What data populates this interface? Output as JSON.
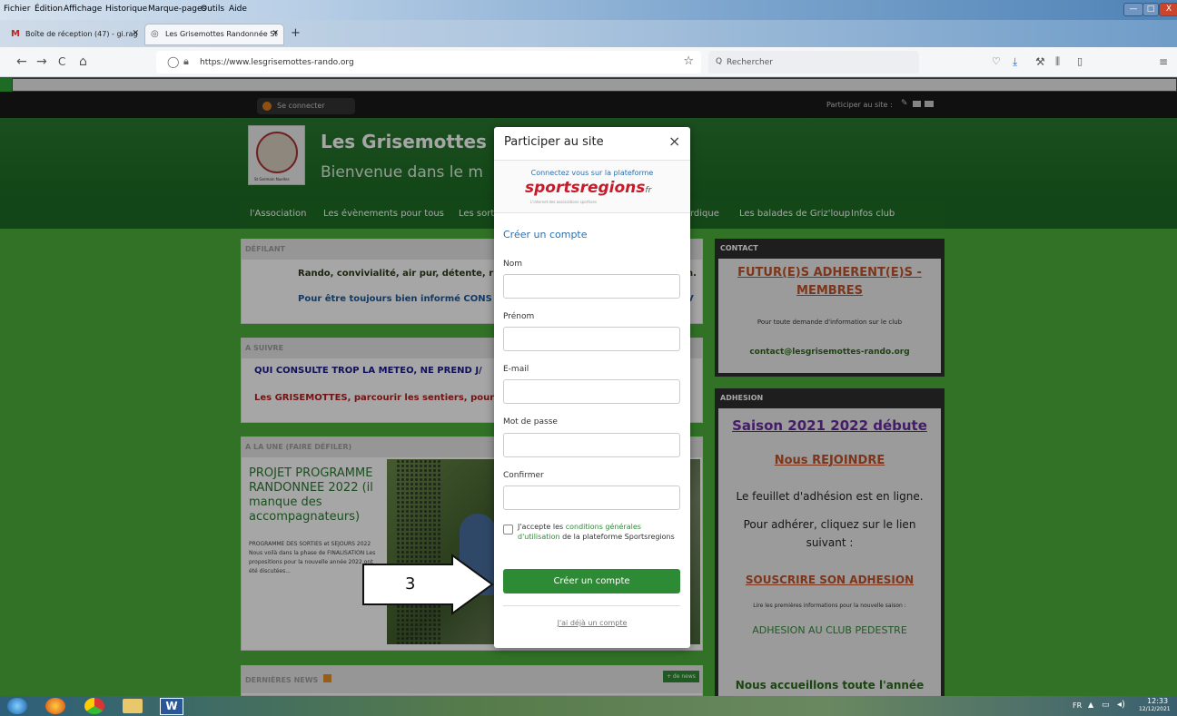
{
  "menubar": {
    "items": [
      "Fichier",
      "Édition",
      "Affichage",
      "Historique",
      "Marque-pages",
      "Outils",
      "Aide"
    ],
    "shortcut_letters": [
      "F",
      "o",
      "A",
      "H",
      "M",
      "O",
      "e"
    ],
    "min_label": "—",
    "max_label": "□",
    "close_label": "X"
  },
  "tabs": [
    {
      "label": "Boîte de réception (47) - gi.rag",
      "icon": "M",
      "close": "✕"
    },
    {
      "label": "Les Grisemottes Randonnée St",
      "icon": "◎",
      "close": "✕"
    }
  ],
  "new_tab_label": "+",
  "nav": {
    "back": "←",
    "forward": "→",
    "reload": "C",
    "home": "⌂",
    "url": "https://www.lesgrisemottes-rando.org",
    "star": "☆",
    "search_placeholder": "Rechercher",
    "search_icon": "Q"
  },
  "site": {
    "login": "Se connecter",
    "participate": "Participer au site :",
    "title": "Les Grisemottes",
    "subtitle": "Bienvenue dans le m",
    "logo_caption": "St Germain Nuelles",
    "nav_items": [
      "l'Association",
      "Les évènements pour tous",
      "Les sorti",
      "rdique",
      "Les balades de Griz'loup",
      "Infos club"
    ],
    "defilant": {
      "title": "DÉFILANT",
      "line1": "Rando, convivialité, air pur, détente, r",
      "line1_tail": "n.",
      "line2": "Pour être toujours bien informé CONS",
      "line2_tail": "V"
    },
    "a_suivre": {
      "title": "A SUIVRE",
      "line1": "QUI CONSULTE TROP LA METEO, NE PREND J/",
      "line2": "Les GRISEMOTTES, parcourir les sentiers, pour"
    },
    "a_la_une": {
      "title": "A LA UNE (FAIRE DÉFILER)",
      "headline": "PROJET PROGRAMME RANDONNEE 2022 (il manque des accompagnateurs)",
      "body": "PROGRAMME DES SORTIES et SEJOURS 2022 Nous voilà dans la phase de FINALISATION Les propositions pour la nouvelle année 2022 ont été discutées..."
    },
    "dernieres": {
      "title": "DERNIÈRES NEWS",
      "more": "+ de news"
    },
    "contact": {
      "title": "CONTACT",
      "heading": "FUTUR(E)S ADHERENT(E)S - MEMBRES",
      "info": "Pour toute demande d'information sur le club",
      "email": "contact@lesgrisemottes-rando.org"
    },
    "adhesion": {
      "title": "ADHESION",
      "season": "Saison 2021 2022 débute",
      "join": "Nous REJOINDRE",
      "line1": "Le feuillet d'adhésion est en ligne.",
      "line2": "Pour adhérer, cliquez sur le lien suivant :",
      "subscribe": "SOUSCRIRE SON ADHESION",
      "small": "Lire les premières informations pour la nouvelle saison :",
      "big": "ADHESION AU CLUB PEDESTRE",
      "welcome": "Nous accueillons toute l'année"
    }
  },
  "modal": {
    "title": "Participer au site",
    "close": "×",
    "connect_text": "Connectez vous sur la plateforme",
    "brand": "sportsregions",
    "brand_tld": "fr",
    "brand_tagline": "L'internet des associations sportives",
    "create_heading": "Créer un compte",
    "fields": {
      "nom": "Nom",
      "prenom": "Prénom",
      "email": "E-mail",
      "password": "Mot de passe",
      "confirm": "Confirmer"
    },
    "accept_prefix": "J'accepte les ",
    "accept_link": "conditions générales d'utilisation",
    "accept_suffix": " de la plateforme Sportsregions",
    "submit": "Créer un compte",
    "already": "J'ai déjà un compte"
  },
  "annotation": {
    "number": "3"
  },
  "taskbar": {
    "lang": "FR",
    "time": "12:33",
    "date": "12/12/2021"
  },
  "colors": {
    "green_dark": "#1f6d25",
    "green_light": "#4caf3c",
    "orange": "#c0522a",
    "purple": "#6a2ca0",
    "button_green": "#2e8b35"
  }
}
